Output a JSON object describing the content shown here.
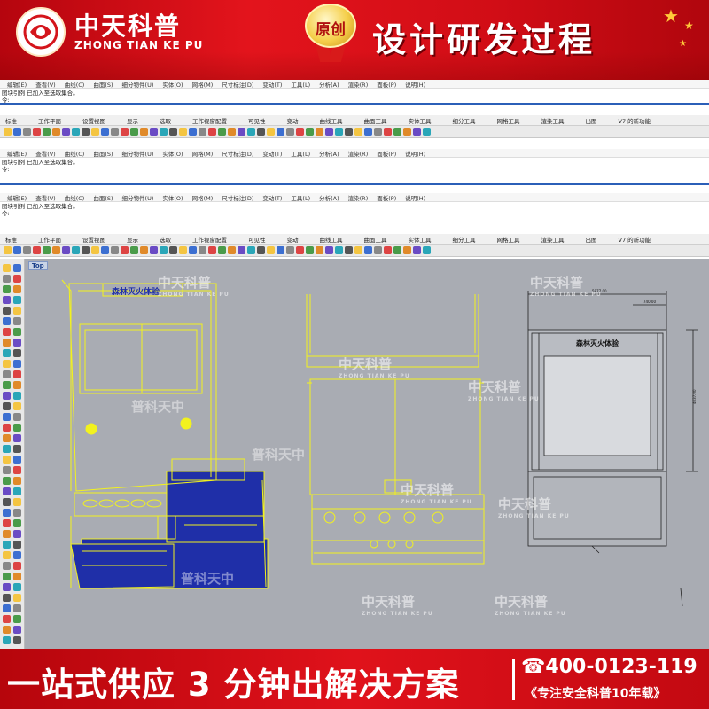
{
  "banner": {
    "brand_cn": "中天科普",
    "brand_en": "ZHONG TIAN KE PU",
    "badge": "原创",
    "headline": "设计研发过程"
  },
  "cad": {
    "menu1": [
      "编辑(E)",
      "查看(V)",
      "曲线(C)",
      "曲面(S)",
      "细分物件(U)",
      "实体(O)",
      "网格(M)",
      "尺寸标注(D)",
      "变动(T)",
      "工具(L)",
      "分析(A)",
      "渲染(R)",
      "面板(P)",
      "说明(H)"
    ],
    "menu2": [
      "编辑(E)",
      "查看(V)",
      "曲线(C)",
      "曲面(S)",
      "细分物件(U)",
      "实体(O)",
      "网格(M)",
      "尺寸标注(D)",
      "变动(T)",
      "工具(L)",
      "分析(A)",
      "渲染(R)",
      "面板(P)",
      "说明(H)"
    ],
    "menu3": [
      "编辑(E)",
      "查看(V)",
      "曲线(C)",
      "曲面(S)",
      "细分物件(U)",
      "实体(O)",
      "网格(M)",
      "尺寸标注(D)",
      "变动(T)",
      "工具(L)",
      "分析(A)",
      "渲染(R)",
      "面板(P)",
      "说明(H)"
    ],
    "cmd_msg": "图块引例 已加入至选取集合。",
    "cmd_prompt": "令:",
    "tabs": [
      "标准",
      "工作平面",
      "设置视图",
      "显示",
      "选取",
      "工作视窗配置",
      "可见性",
      "变动",
      "曲线工具",
      "曲面工具",
      "实体工具",
      "细分工具",
      "网格工具",
      "渲染工具",
      "出图",
      "V7 的新功能"
    ],
    "viewport_label": "Top",
    "sign_text": "森林灭火体验",
    "dim_top": "5877.00",
    "dim_mid": "740.00",
    "dim_side": "4637.00"
  },
  "watermark": {
    "cn": "中天科普",
    "en": "ZHONG TIAN KE PU",
    "mirror_cn": "普科天中"
  },
  "footer": {
    "slogan": "一站式供应 3 分钟出解决方案",
    "phone": "☎400-0123-119",
    "tagline": "《专注安全科普10年载》"
  },
  "colors": {
    "brand_red": "#e3141c",
    "viewport": "#a9acb3",
    "wire": "#f2f21e",
    "solid": "#1f2fa8"
  }
}
